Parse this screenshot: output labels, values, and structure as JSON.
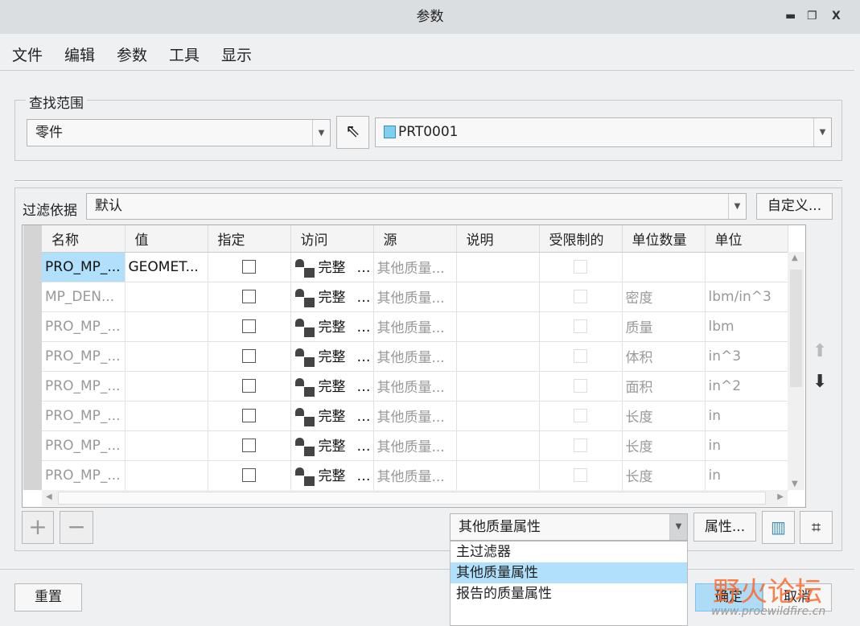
{
  "window": {
    "title": "参数",
    "minimize": "▬",
    "maximize": "❐",
    "close": "X"
  },
  "menu": [
    "文件",
    "编辑",
    "参数",
    "工具",
    "显示"
  ],
  "scope": {
    "label": "查找范围",
    "type": "零件",
    "model": "PRT0001"
  },
  "filter": {
    "label": "过滤依据",
    "value": "默认",
    "customize": "自定义..."
  },
  "table": {
    "headers": [
      "名称",
      "值",
      "指定",
      "访问",
      "源",
      "说明",
      "受限制的",
      "单位数量",
      "单位"
    ],
    "rows": [
      {
        "name": "PRO_MP_...",
        "value": "GEOMET...",
        "access": "完整",
        "source": "其他质量...",
        "desc": "",
        "qty": "",
        "unit": ""
      },
      {
        "name": "MP_DEN...",
        "value": "",
        "access": "完整",
        "source": "其他质量...",
        "desc": "",
        "qty": "密度",
        "unit": "lbm/in^3"
      },
      {
        "name": "PRO_MP_...",
        "value": "",
        "access": "完整",
        "source": "其他质量...",
        "desc": "",
        "qty": "质量",
        "unit": "lbm"
      },
      {
        "name": "PRO_MP_...",
        "value": "",
        "access": "完整",
        "source": "其他质量...",
        "desc": "",
        "qty": "体积",
        "unit": "in^3"
      },
      {
        "name": "PRO_MP_...",
        "value": "",
        "access": "完整",
        "source": "其他质量...",
        "desc": "",
        "qty": "面积",
        "unit": "in^2"
      },
      {
        "name": "PRO_MP_...",
        "value": "",
        "access": "完整",
        "source": "其他质量...",
        "desc": "",
        "qty": "长度",
        "unit": "in"
      },
      {
        "name": "PRO_MP_...",
        "value": "",
        "access": "完整",
        "source": "其他质量...",
        "desc": "",
        "qty": "长度",
        "unit": "in"
      },
      {
        "name": "PRO_MP_...",
        "value": "",
        "access": "完整",
        "source": "其他质量...",
        "desc": "",
        "qty": "长度",
        "unit": "in"
      }
    ]
  },
  "bottom": {
    "add": "+",
    "remove": "−",
    "set_value": "其他质量属性",
    "options": [
      "主过滤器",
      "其他质量属性",
      "报告的质量属性"
    ],
    "properties": "属性..."
  },
  "footer": {
    "reset": "重置",
    "ok": "确定",
    "cancel": "取消"
  },
  "watermark": {
    "logo": "野火论坛",
    "url": "www.proewildfire.cn"
  }
}
